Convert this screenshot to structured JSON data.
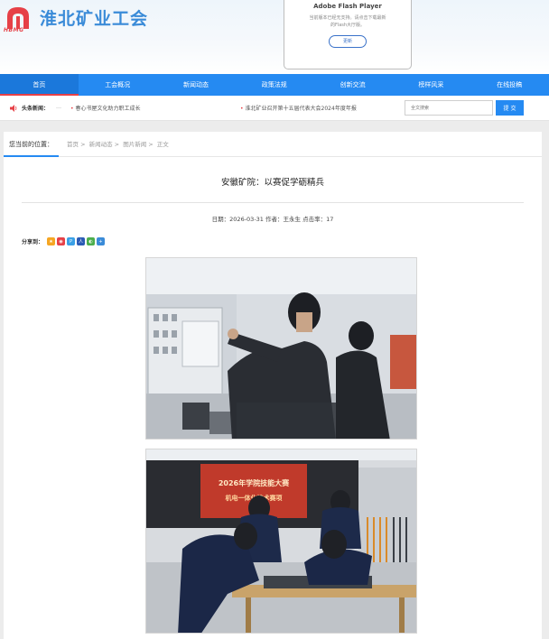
{
  "header": {
    "site_title": "淮北矿业工会",
    "logo_sub": "HBMG",
    "accent_color": "#258af2",
    "logo_color": "#e64047"
  },
  "flash_notice": {
    "title": "Adobe Flash Player",
    "text": "当前版本已经无支持。请点击下载最新的Flash大厅版。",
    "button": "更新"
  },
  "nav": {
    "items": [
      "首页",
      "工会概况",
      "新闻动态",
      "政策法规",
      "创新交流",
      "榜样风采",
      "在线投稿"
    ]
  },
  "ticker": {
    "icon": "speaker-icon",
    "label": "头条新闻：",
    "separator": "…",
    "items": [
      "春心书屋文化助力职工成长",
      "淮北矿业召开第十五届代表大会2024年度年报"
    ]
  },
  "search": {
    "placeholder": "全文搜索",
    "button": "提 交"
  },
  "breadcrumb": {
    "label": "您当前的位置：",
    "items": [
      "首页 >",
      "新闻动态 >",
      "图片新闻 >",
      "正文"
    ]
  },
  "article": {
    "title": "安徽矿院：以赛促学砺精兵",
    "meta": "日期：2026-03-31 作者：王永生 点击率：17",
    "share_label": "分享到：",
    "share_icons": [
      "qzone-icon",
      "weibo-icon",
      "pinterest-icon",
      "renren-icon",
      "wechat-icon",
      "more-share-icon"
    ],
    "photo2_banner_line1": "2026年学院技能大赛",
    "photo2_banner_line2": "机电一体化技术赛项"
  }
}
